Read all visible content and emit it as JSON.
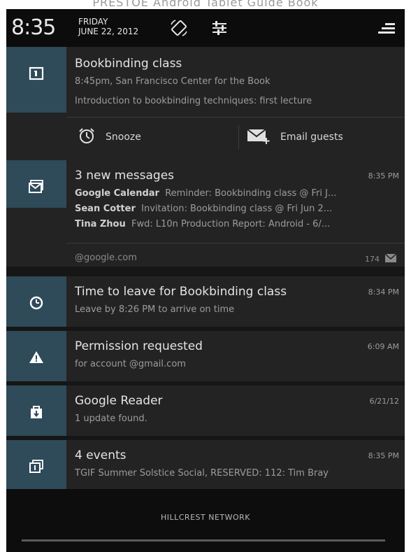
{
  "caption": "PRESTOE  Android Tablet Guide Book",
  "status_bar": {
    "time": "8:35",
    "day": "FRIDAY",
    "date": "JUNE 22, 2012",
    "icons": [
      "auto-rotate-icon",
      "quick-settings-icon",
      "notification-menu-icon"
    ]
  },
  "notifications": {
    "calendar": {
      "icon": "calendar-icon",
      "title": "Bookbinding class",
      "subtitle": "8:45pm, San Francisco Center for the Book",
      "description": "Introduction to bookbinding techniques: first lecture",
      "actions": {
        "snooze": {
          "label": "Snooze",
          "icon": "alarm-clock-icon"
        },
        "email": {
          "label": "Email guests",
          "icon": "email-add-icon"
        }
      }
    },
    "gmail": {
      "icon": "gmail-icon",
      "title": "3 new messages",
      "time": "8:35 PM",
      "messages": [
        {
          "sender": "Google Calendar",
          "text": "Reminder: Bookbinding class @ Fri J..."
        },
        {
          "sender": "Sean Cotter",
          "text": "Invitation: Bookbinding class @ Fri Jun 2..."
        },
        {
          "sender": "Tina Zhou",
          "text": "Fwd: L10n Production Report: Android - 6/..."
        }
      ],
      "account": "@google.com",
      "unread_count": "174"
    },
    "leave": {
      "icon": "clock-icon",
      "title": "Time to leave for Bookbinding class",
      "subtitle": "Leave by 8:26 PM to arrive on time",
      "time": "8:34 PM"
    },
    "permission": {
      "icon": "warning-icon",
      "title": "Permission requested",
      "subtitle": "for account @gmail.com",
      "time": "6:09 AM"
    },
    "reader": {
      "icon": "update-icon",
      "title": "Google Reader",
      "subtitle": "1 update found.",
      "time": "6/21/12"
    },
    "events": {
      "icon": "events-icon",
      "title": "4 events",
      "subtitle": "TGIF Summer Solstice Social, RESERVED: 112: Tim Bray",
      "time": "8:35 PM"
    }
  },
  "carrier": "HILLCREST NETWORK",
  "colors": {
    "icon_cell": "#2f4a59",
    "panel": "#232323",
    "background": "#161616"
  }
}
